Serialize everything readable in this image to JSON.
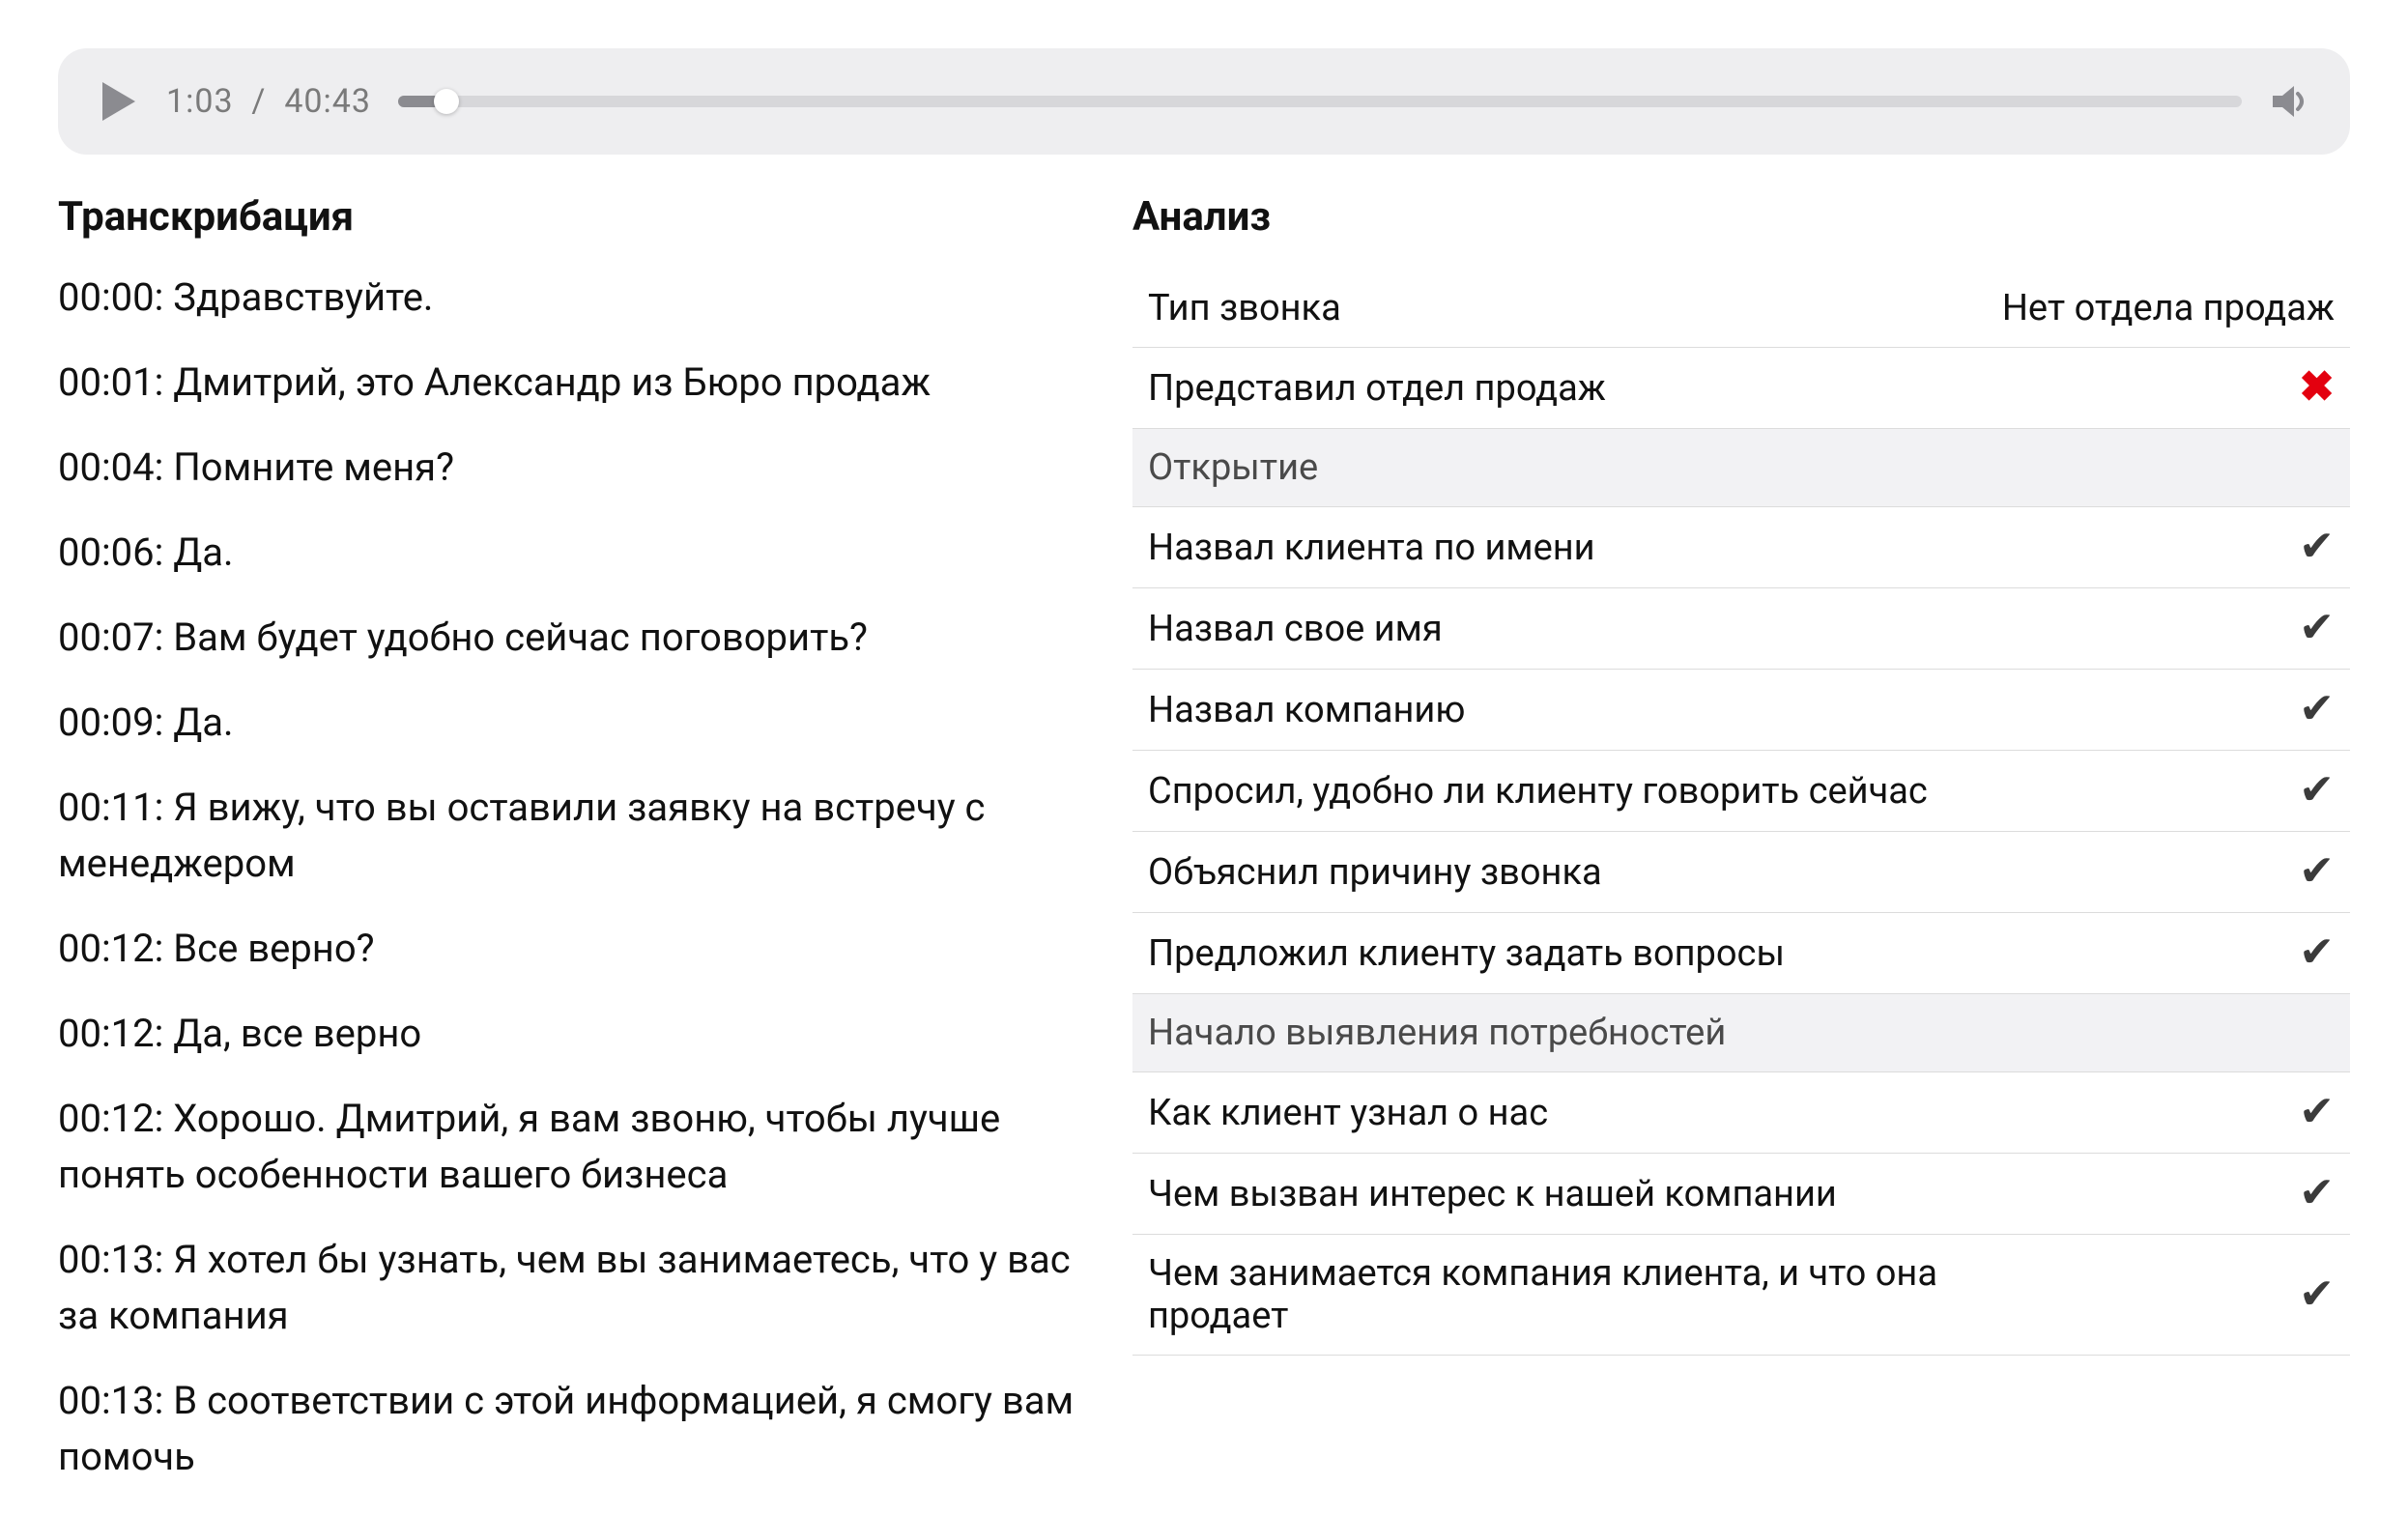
{
  "player": {
    "current_time": "1:03",
    "total_time": "40:43",
    "progress_percent": 2.6
  },
  "transcript": {
    "title": "Транскрибация",
    "lines": [
      {
        "time": "00:00",
        "text": "Здравствуйте."
      },
      {
        "time": "00:01",
        "text": "Дмитрий, это Александр из Бюро продаж"
      },
      {
        "time": "00:04",
        "text": "Помните меня?"
      },
      {
        "time": "00:06",
        "text": "Да."
      },
      {
        "time": "00:07",
        "text": "Вам будет удобно сейчас поговорить?"
      },
      {
        "time": "00:09",
        "text": "Да."
      },
      {
        "time": "00:11",
        "text": "Я вижу, что вы оставили заявку на встречу с менеджером"
      },
      {
        "time": "00:12",
        "text": "Все верно?"
      },
      {
        "time": "00:12",
        "text": "Да, все верно"
      },
      {
        "time": "00:12",
        "text": "Хорошо. Дмитрий, я вам звоню, чтобы лучше понять особенности вашего бизнеса"
      },
      {
        "time": "00:13",
        "text": "Я хотел бы узнать, чем вы занимаетесь, что у вас за компания"
      },
      {
        "time": "00:13",
        "text": "В соответствии с этой информацией, я смогу вам помочь"
      }
    ]
  },
  "analysis": {
    "title": "Анализ",
    "rows": [
      {
        "type": "kv",
        "label": "Тип звонка",
        "value": "Нет отдела продаж"
      },
      {
        "type": "status",
        "label": "Представил отдел продаж",
        "status": "fail"
      },
      {
        "type": "section",
        "label": "Открытие"
      },
      {
        "type": "status",
        "label": "Назвал клиента по имени",
        "status": "pass"
      },
      {
        "type": "status",
        "label": "Назвал свое имя",
        "status": "pass"
      },
      {
        "type": "status",
        "label": "Назвал компанию",
        "status": "pass"
      },
      {
        "type": "status",
        "label": "Спросил, удобно ли клиенту говорить сейчас",
        "status": "pass"
      },
      {
        "type": "status",
        "label": "Объяснил причину звонка",
        "status": "pass"
      },
      {
        "type": "status",
        "label": "Предложил клиенту задать вопросы",
        "status": "pass"
      },
      {
        "type": "section",
        "label": "Начало выявления потребностей"
      },
      {
        "type": "status",
        "label": "Как клиент узнал о нас",
        "status": "pass"
      },
      {
        "type": "status",
        "label": "Чем вызван интерес к нашей компании",
        "status": "pass"
      },
      {
        "type": "status",
        "label": "Чем занимается компания клиента, и что она продает",
        "status": "pass"
      }
    ]
  },
  "icons": {
    "pass": "✔",
    "fail": "✖"
  }
}
